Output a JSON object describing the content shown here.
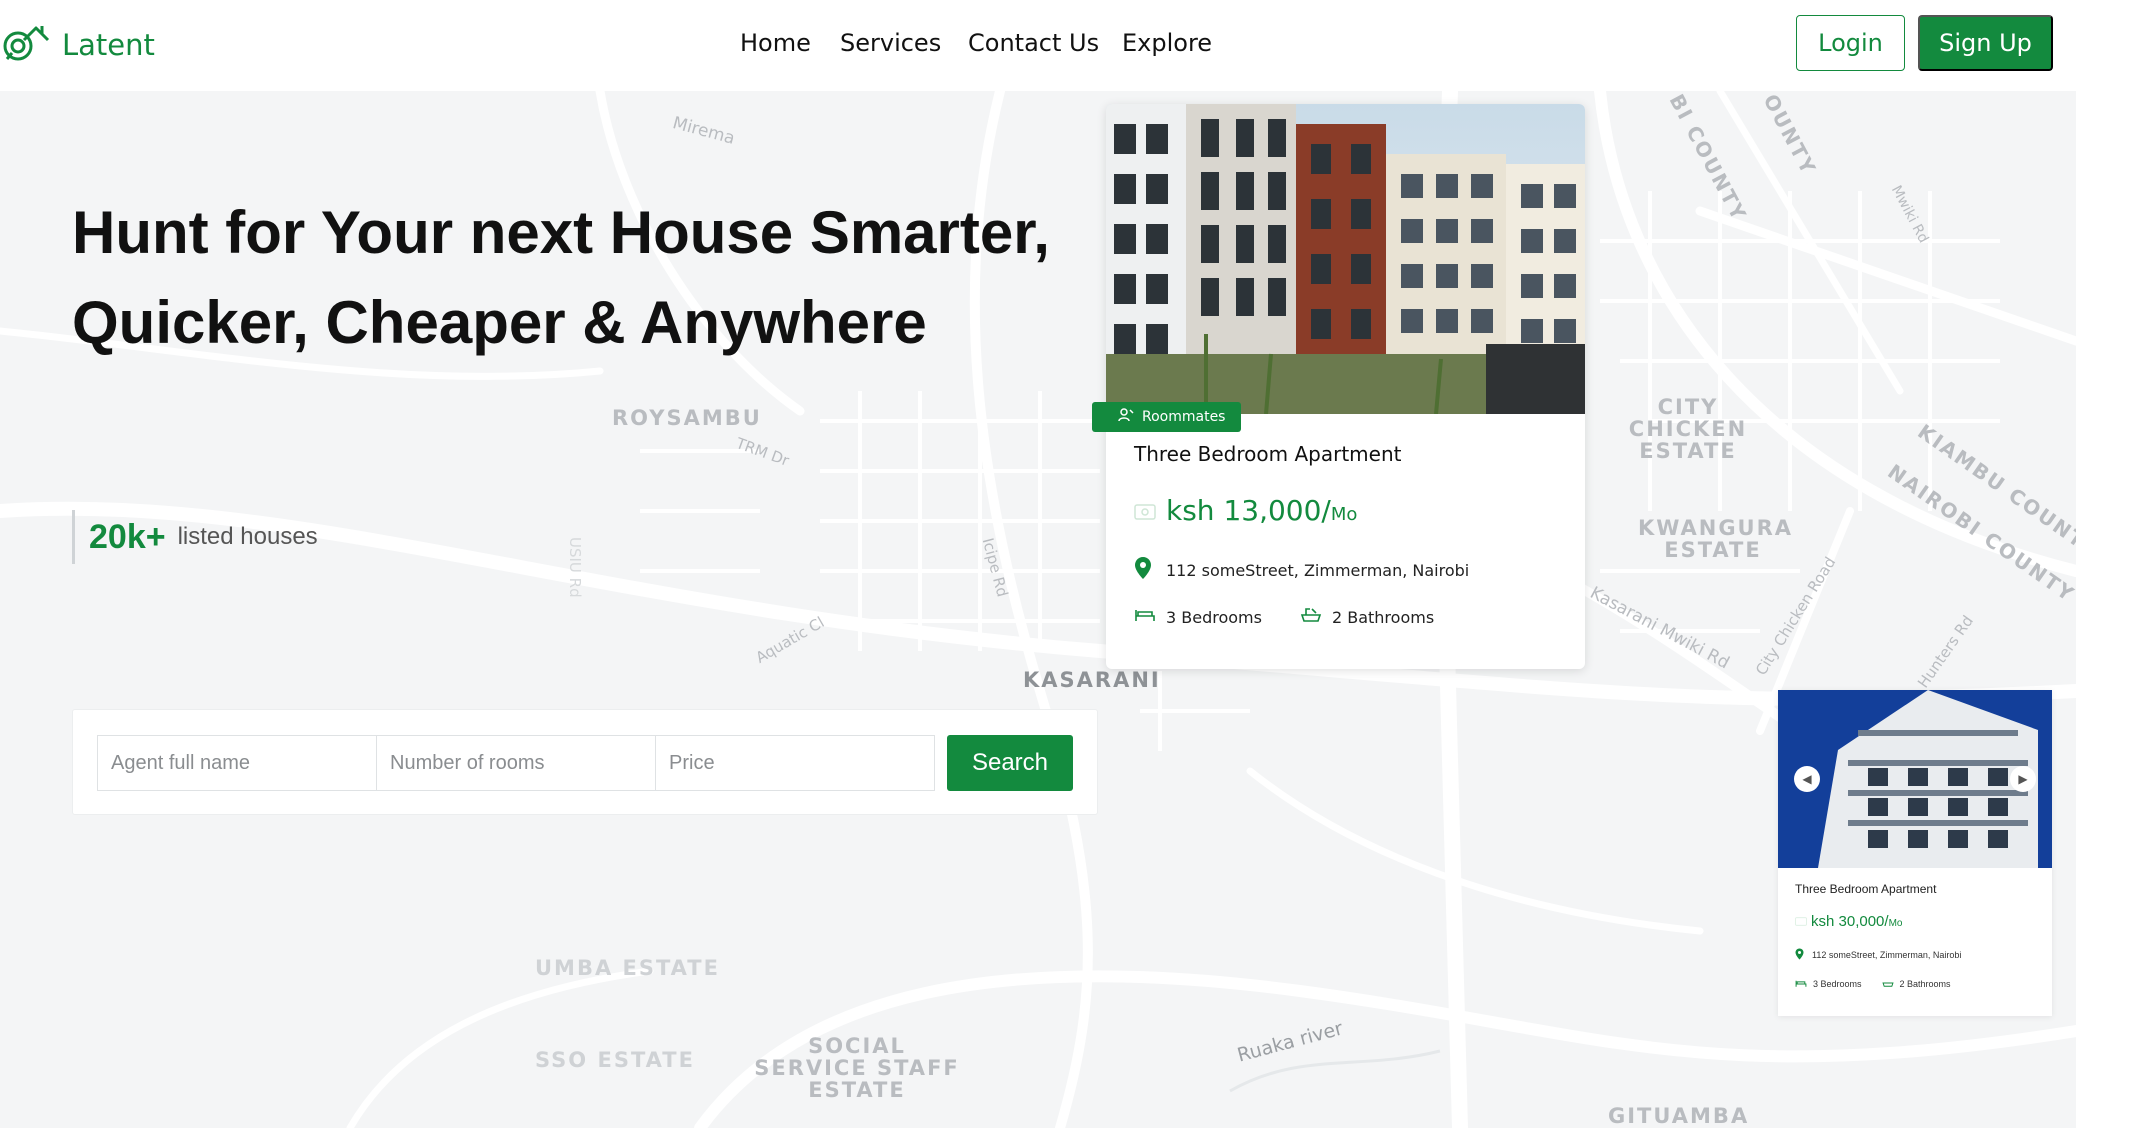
{
  "brand": {
    "name": "Latent",
    "color": "#138a3e"
  },
  "nav": {
    "links": [
      "Home",
      "Services",
      "Contact Us",
      "Explore"
    ],
    "login": "Login",
    "signup": "Sign Up"
  },
  "hero": {
    "title": "Hunt for Your next House Smarter, Quicker, Cheaper & Anywhere",
    "stats_count": "20k+",
    "stats_label": "listed houses"
  },
  "search": {
    "agent_placeholder": "Agent full name",
    "rooms_placeholder": "Number of rooms",
    "price_placeholder": "Price",
    "button": "Search"
  },
  "featured_card": {
    "badge": "Roommates",
    "title": "Three Bedroom Apartment",
    "price": "ksh 13,000/",
    "price_unit": "Mo",
    "address": "112 someStreet, Zimmerman, Nairobi",
    "bedrooms": "3 Bedrooms",
    "bathrooms": "2 Bathrooms"
  },
  "small_card": {
    "title": "Three Bedroom Apartment",
    "price": "ksh 30,000/",
    "price_unit": "Mo",
    "address": "112 someStreet, Zimmerman, Nairobi",
    "bedrooms": "3 Bedrooms",
    "bathrooms": "2 Bathrooms"
  },
  "map_labels": {
    "roysambu": "ROYSAMBU",
    "kasarani": "KASARANI",
    "city_chicken": "CITY CHICKEN ESTATE",
    "kwangura": "KWANGURA ESTATE",
    "kiambu_county": "KIAMBU COUNTY",
    "nairobi_county": "NAIROBI COUNTY",
    "bi_county": "BI COUNTY",
    "ounty": "OUNTY",
    "umba_estate": "UMBA ESTATE",
    "sso_estate": "SSO ESTATE",
    "social_service": "SOCIAL SERVICE STAFF ESTATE",
    "gituamba": "GITUAMBA",
    "mirema": "Mirema",
    "trm_dr": "TRM Dr",
    "icipe_rd": "Icipe Rd",
    "aquatic_cl": "Aquatic Cl",
    "usiu_rd": "USIU Rd",
    "kasarani_mwiki": "Kasarani Mwiki Rd",
    "city_chicken_road": "City Chicken Road",
    "hunters_rd": "Hunters Rd",
    "mwiki_rd": "Mwiki Rd",
    "ruaka_river": "Ruaka river"
  }
}
